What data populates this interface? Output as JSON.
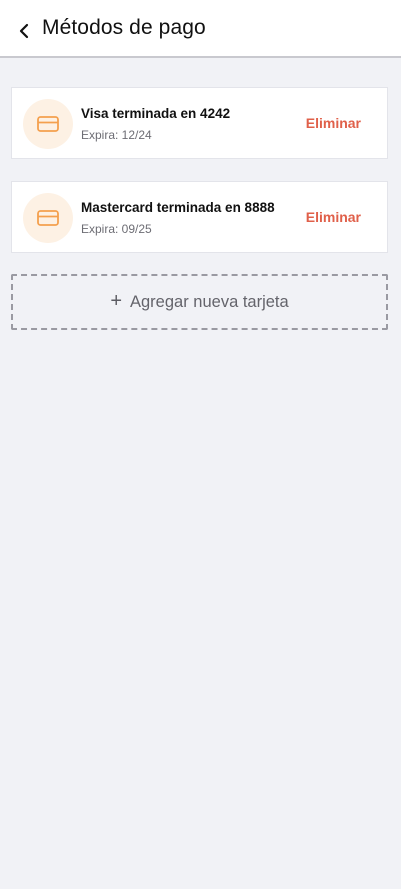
{
  "header": {
    "title": "Métodos de pago",
    "back_icon": "chevron-left-icon"
  },
  "cards": [
    {
      "name": "Visa terminada en 4242",
      "expiry": "Expira: 12/24",
      "delete_label": "Eliminar",
      "icon": "credit-card-icon"
    },
    {
      "name": "Mastercard terminada en 8888",
      "expiry": "Expira: 09/25",
      "delete_label": "Eliminar",
      "icon": "credit-card-icon"
    }
  ],
  "add_card": {
    "plus": "+",
    "label": "Agregar nueva tarjeta"
  },
  "colors": {
    "accent_orange": "#f4a04e",
    "icon_bg": "#fdf1e4",
    "delete_red": "#e0604a",
    "background": "#f1f2f6"
  }
}
